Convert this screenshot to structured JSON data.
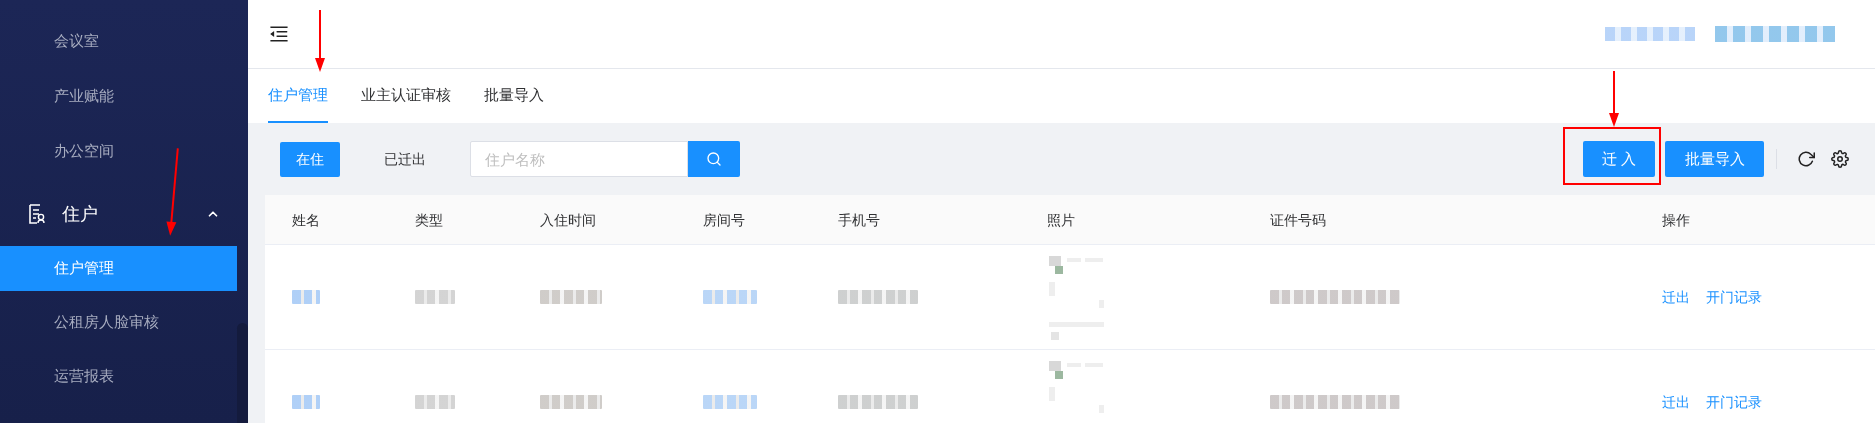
{
  "sidebar": {
    "items": [
      {
        "label": "会议室",
        "kind": "link",
        "selected": false
      },
      {
        "label": "产业赋能",
        "kind": "link",
        "selected": false
      },
      {
        "label": "办公空间",
        "kind": "link",
        "selected": false
      },
      {
        "label": "住户",
        "kind": "group",
        "expanded": true,
        "children": [
          {
            "label": "住户管理",
            "selected": true
          },
          {
            "label": "公租房人脸审核",
            "selected": false
          },
          {
            "label": "运营报表",
            "selected": false
          }
        ]
      }
    ]
  },
  "tabs": [
    {
      "label": "住户管理",
      "selected": true
    },
    {
      "label": "业主认证审核",
      "selected": false
    },
    {
      "label": "批量导入",
      "selected": false
    }
  ],
  "filters": [
    {
      "label": "在住",
      "selected": true
    },
    {
      "label": "已迁出",
      "selected": false
    }
  ],
  "search": {
    "placeholder": "住户名称"
  },
  "actions": [
    "迁 入",
    "批量导入"
  ],
  "table": {
    "columns": [
      "姓名",
      "类型",
      "入住时间",
      "房间号",
      "手机号",
      "照片",
      "证件号码",
      "操作"
    ],
    "rows": [
      {
        "actions": [
          "迁出",
          "开门记录"
        ]
      },
      {
        "actions": [
          "迁出",
          "开门记录"
        ]
      }
    ]
  }
}
